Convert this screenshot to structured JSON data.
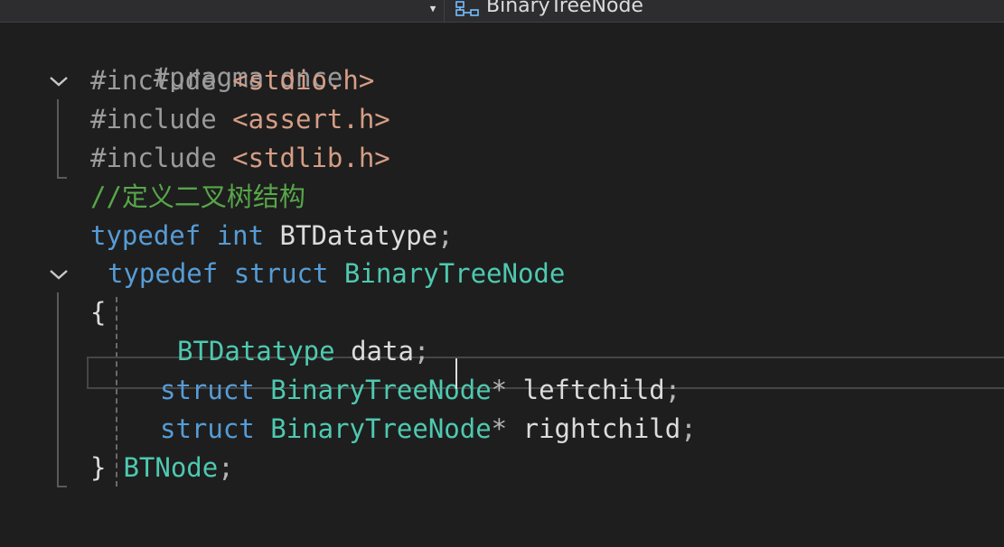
{
  "navbar": {
    "member_name": "BinaryTreeNode",
    "dropdown_icon": "triangle-down",
    "member_icon": "class-icon"
  },
  "colors": {
    "background": "#1e1e1e",
    "preprocessor": "#9b9b9b",
    "string": "#d69d85",
    "comment": "#57a64a",
    "keyword": "#569cd6",
    "type": "#4ec9b0",
    "identifier": "#dcdcdc"
  },
  "code": {
    "l1": {
      "directive": "#pragma once"
    },
    "l2": {
      "directive": "#include ",
      "header": "<stdio.h>"
    },
    "l3": {
      "directive": "#include ",
      "header": "<assert.h>"
    },
    "l4": {
      "directive": "#include ",
      "header": "<stdlib.h>"
    },
    "l5": {
      "comment": "//定义二叉树结构"
    },
    "l6": {
      "kw1": "typedef",
      "kw2": "int",
      "name": "BTDatatype",
      "punct": ";"
    },
    "l7": {
      "kw1": "typedef",
      "kw2": "struct",
      "type": "BinaryTreeNode"
    },
    "l8": {
      "brace": "{"
    },
    "l9": {
      "type": "BTDatatype",
      "field": "data",
      "punct": ";"
    },
    "l10": {
      "kw": "struct",
      "type": "BinaryTreeNode",
      "star": "*",
      "field": "leftchild",
      "punct": ";"
    },
    "l11": {
      "kw": "struct",
      "type": "BinaryTreeNode",
      "star": "*",
      "field": "rightchild",
      "punct": ";"
    },
    "l12": {
      "brace": "}",
      "type": "BTNode",
      "punct": ";"
    }
  }
}
